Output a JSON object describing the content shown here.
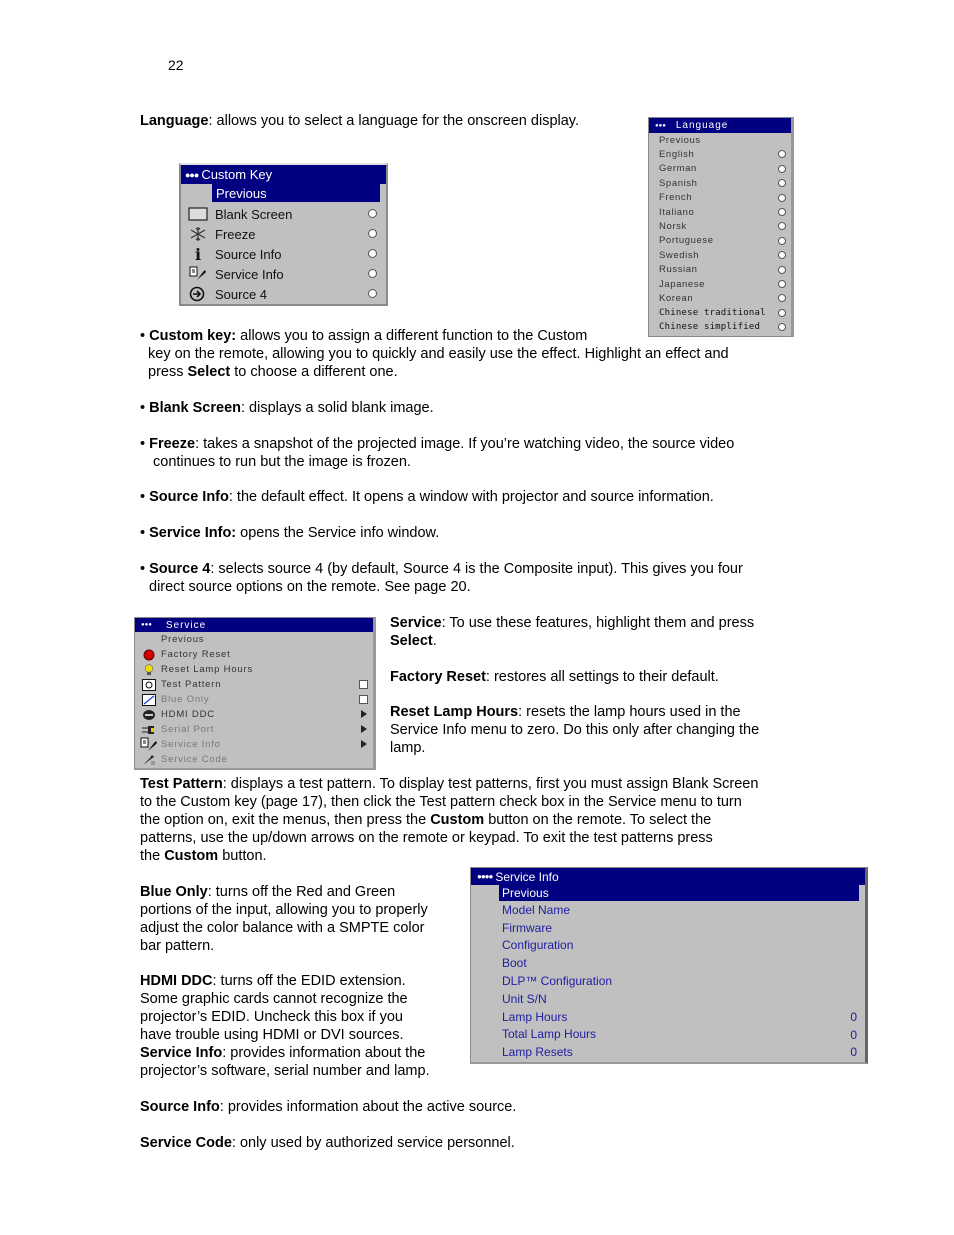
{
  "page_number": "22",
  "language_para": {
    "term": "Language",
    "text": ": allows you to select a language for the onscreen display."
  },
  "language_menu": {
    "title_dots": "●●●",
    "title": "Language",
    "items": [
      {
        "label": "Previous",
        "control": "none"
      },
      {
        "label": "English",
        "control": "radio"
      },
      {
        "label": "German",
        "control": "radio"
      },
      {
        "label": "Spanish",
        "control": "radio"
      },
      {
        "label": "French",
        "control": "radio"
      },
      {
        "label": "Italiano",
        "control": "radio"
      },
      {
        "label": "Norsk",
        "control": "radio"
      },
      {
        "label": "Portuguese",
        "control": "radio"
      },
      {
        "label": "Swedish",
        "control": "radio"
      },
      {
        "label": "Russian",
        "control": "radio"
      },
      {
        "label": "Japanese",
        "control": "radio"
      },
      {
        "label": "Korean",
        "control": "radio"
      },
      {
        "label": "Chinese traditional",
        "control": "radio"
      },
      {
        "label": "Chinese simplified",
        "control": "radio"
      }
    ]
  },
  "custom_key_menu": {
    "title_dots": "●●●",
    "title": "Custom Key",
    "selected": "Previous",
    "items": [
      {
        "label": "Blank Screen",
        "icon": "blank-screen-icon"
      },
      {
        "label": "Freeze",
        "icon": "freeze-icon"
      },
      {
        "label": "Source Info",
        "icon": "info-icon"
      },
      {
        "label": "Service Info",
        "icon": "service-wrench-icon"
      },
      {
        "label": "Source 4",
        "icon": "source-input-icon"
      }
    ]
  },
  "bullets": [
    {
      "term": "Custom key:",
      "text": " allows you to assign a different function to the Custom",
      "line2": "key on the remote, allowing you to quickly and easily use the effect. Highlight an effect and",
      "line3a": "press ",
      "line3b": "Select",
      "line3c": " to choose a different one."
    },
    {
      "term": "Blank Screen",
      "text": ": displays a solid blank image."
    },
    {
      "term": "Freeze",
      "text": ": takes a snapshot of the projected image. If you’re watching video, the source video",
      "line2": "continues to run but the image is frozen."
    },
    {
      "term": "Source Info",
      "text": ": the default effect. It opens a window with projector and source information."
    },
    {
      "term": "Service Info:",
      "text": " opens the Service info window."
    },
    {
      "term": "Source 4",
      "text": ": selects source 4 (by default, Source 4 is the Composite input). This gives you four",
      "line2": "direct source options on the remote. See page 20."
    }
  ],
  "bullet_char": "•",
  "service_menu": {
    "title_dots": "●●●",
    "title": "Service",
    "items": [
      {
        "label": "Previous",
        "icon": "none",
        "control": "none"
      },
      {
        "label": "Factory Reset",
        "icon": "factory-reset-icon",
        "control": "none"
      },
      {
        "label": "Reset Lamp Hours",
        "icon": "lamp-icon",
        "control": "none"
      },
      {
        "label": "Test Pattern",
        "icon": "test-pattern-icon",
        "control": "checkbox"
      },
      {
        "label": "Blue Only",
        "icon": "blue-only-icon",
        "control": "checkbox"
      },
      {
        "label": "HDMI DDC",
        "icon": "hdmi-icon",
        "control": "arrow"
      },
      {
        "label": "Serial Port",
        "icon": "serial-port-icon",
        "control": "arrow"
      },
      {
        "label": "Service Info",
        "icon": "service-wrench-icon",
        "control": "arrow"
      },
      {
        "label": "Service Code",
        "icon": "service-code-icon",
        "control": "none"
      }
    ]
  },
  "service_paras": [
    {
      "term": "Service",
      "text": ": To use these features, highlight them and press",
      "line2_bold": "Select",
      "line2": "."
    },
    {
      "term": "Factory Reset",
      "text": ": restores all settings to their default."
    },
    {
      "term": "Reset Lamp Hours",
      "text": ": resets the lamp hours used in the",
      "line2": "Service Info menu to zero. Do this only after changing the",
      "line3": "lamp."
    }
  ],
  "test_pattern_para": {
    "term": "Test Pattern",
    "l1": ": displays a test pattern. To display test patterns, first you must assign Blank Screen",
    "l2": "to the Custom key (page 17), then click the Test pattern check box in the Service menu to turn",
    "l3a": "the option on, exit the menus, then press the ",
    "l3b": "Custom",
    "l3c": " button on the remote. To select the",
    "l4": "patterns, use the up/down arrows on the remote or keypad. To exit the test patterns press",
    "l5a": "the ",
    "l5b": "Custom",
    "l5c": " button."
  },
  "blue_only_para": {
    "term": "Blue Only",
    "l1": ": turns off the Red and Green",
    "l2": "portions of the input, allowing you to properly",
    "l3": "adjust the color balance with a SMPTE color",
    "l4": "bar pattern."
  },
  "hdmi_para": {
    "term": "HDMI DDC",
    "l1": ": turns off the EDID extension.",
    "l2": "Some graphic cards cannot recognize the",
    "l3": "projector’s EDID. Uncheck this box if you",
    "l4": "have trouble using HDMI or DVI sources."
  },
  "service_info_para": {
    "term": "Service Info",
    "l1": ": provides information about the",
    "l2": "projector’s software, serial number and lamp."
  },
  "service_info_menu": {
    "title_dots": "●●●●",
    "title": "Service Info",
    "selected": "Previous",
    "items": [
      {
        "label": "Model Name",
        "value": ""
      },
      {
        "label": "Firmware",
        "value": ""
      },
      {
        "label": "Configuration",
        "value": ""
      },
      {
        "label": "Boot",
        "value": ""
      },
      {
        "label": "DLP™ Configuration",
        "value": ""
      },
      {
        "label": "Unit S/N",
        "value": ""
      },
      {
        "label": "Lamp Hours",
        "value": "0"
      },
      {
        "label": "Total Lamp Hours",
        "value": "0"
      },
      {
        "label": "Lamp Resets",
        "value": "0"
      }
    ]
  },
  "source_info_para": {
    "term": "Source Info",
    "text": ": provides information about the active source."
  },
  "service_code_para": {
    "term": "Service Code",
    "text": ": only used by authorized service personnel."
  }
}
